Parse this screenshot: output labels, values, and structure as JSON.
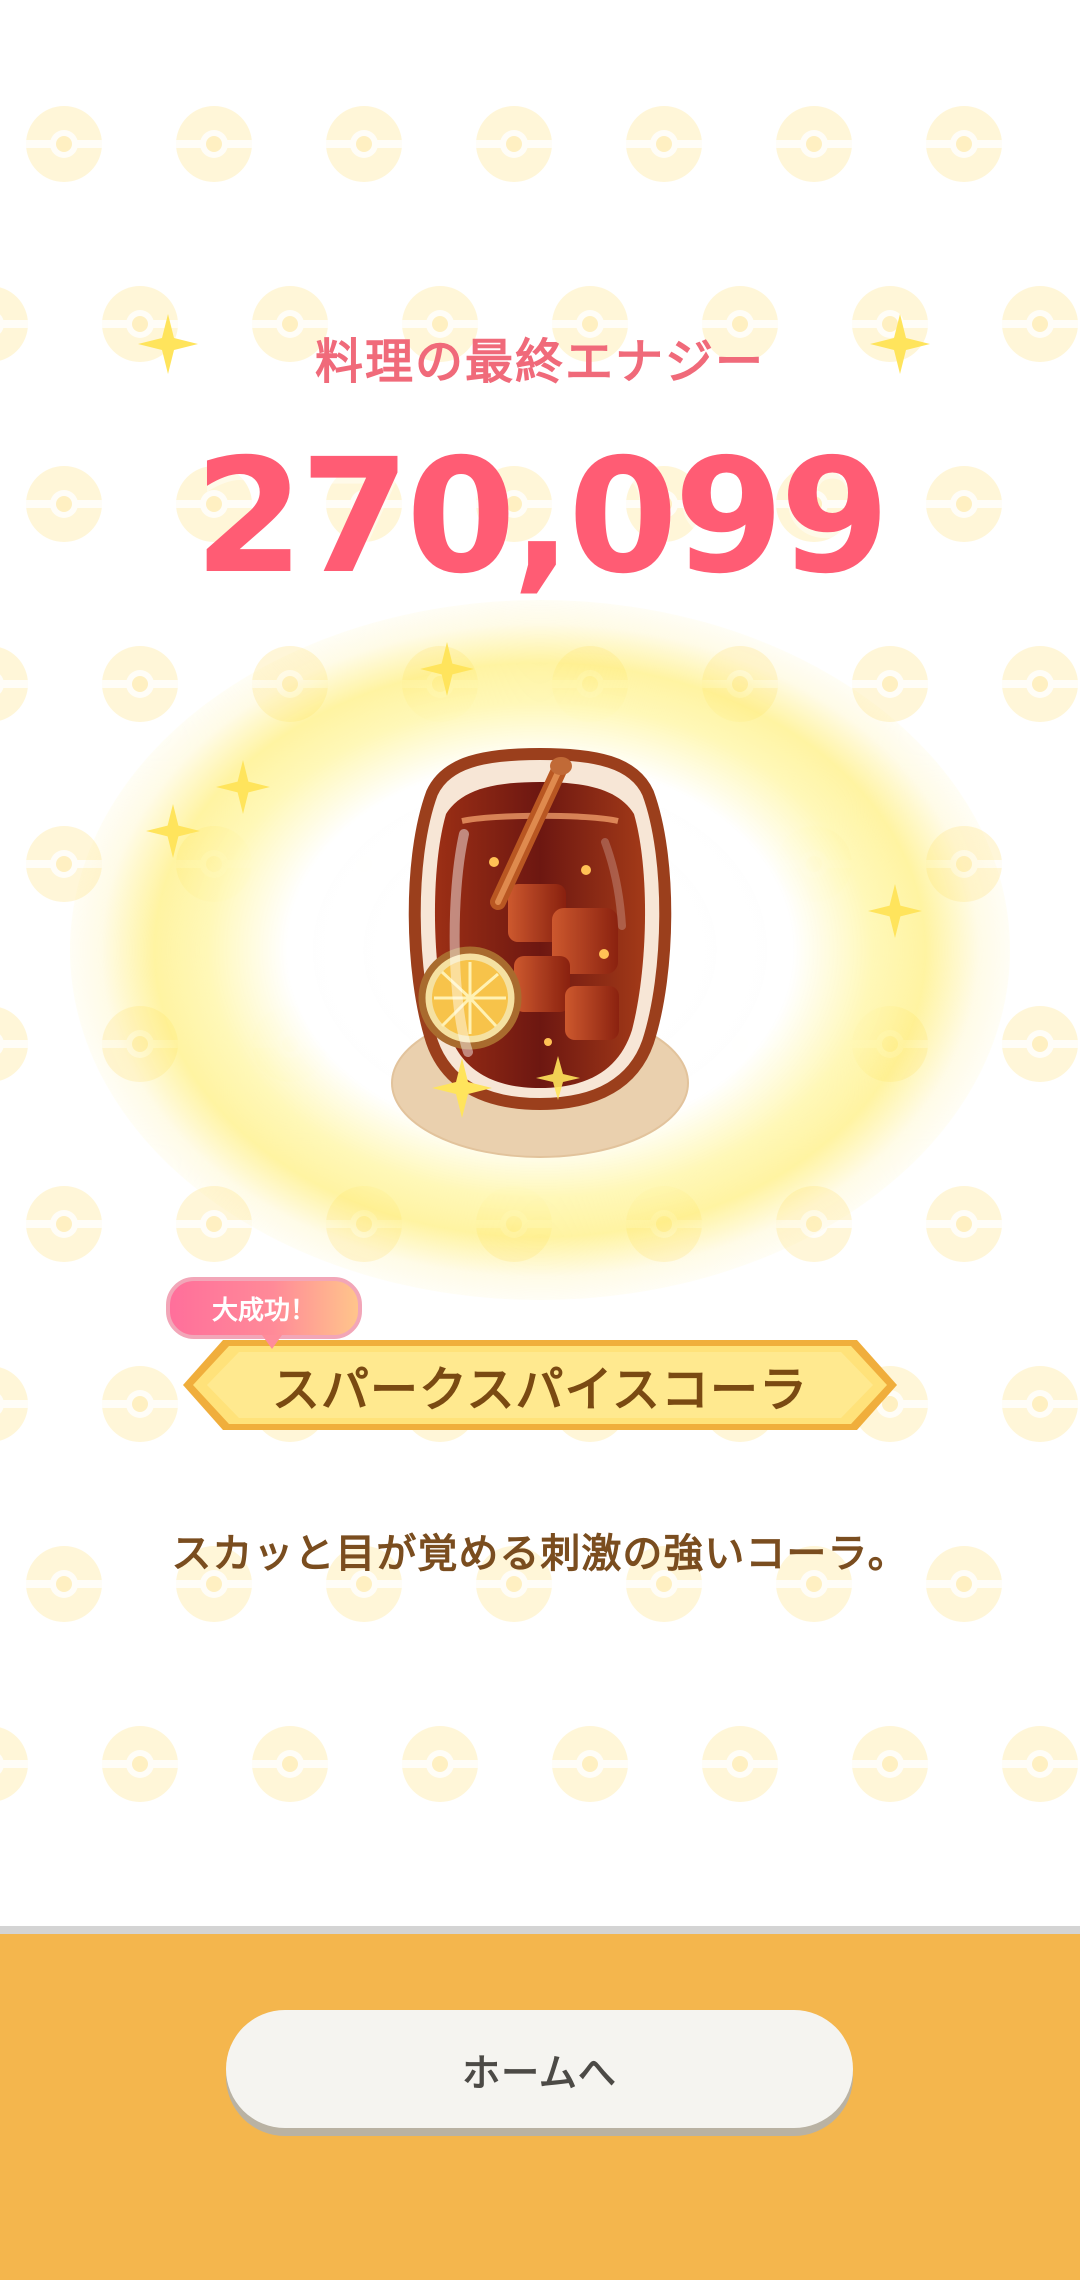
{
  "result": {
    "title": "料理の最終エナジー",
    "energy_value": "270,099"
  },
  "dish": {
    "success_badge": "大成功！",
    "name": "スパークスパイスコーラ",
    "description": "スカッと目が覚める刺激の強いコーラ。"
  },
  "footer": {
    "home_button_label": "ホームへ"
  },
  "colors": {
    "title": "#f06a7a",
    "energy": "#ff5c74",
    "banner_fill": "#ffe27a",
    "footer": "#f4b64d",
    "button": "#f5f4f0"
  },
  "icons": {
    "drink": "sparkling-spice-cola-icon",
    "sparkle": "sparkle-icon",
    "pattern": "pokeball-pattern"
  }
}
